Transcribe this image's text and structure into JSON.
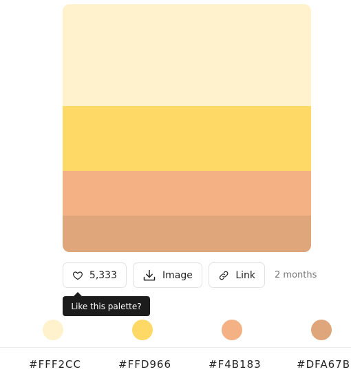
{
  "palette": {
    "colors": [
      "#FFF2CC",
      "#FFD966",
      "#F4B183",
      "#DFA67B"
    ]
  },
  "actions": {
    "like_count": "5,333",
    "image_label": "Image",
    "link_label": "Link",
    "age": "2 months"
  },
  "tooltip": {
    "text": "Like this palette?"
  },
  "codes": [
    "#FFF2CC",
    "#FFD966",
    "#F4B183",
    "#DFA67B"
  ],
  "icons": {
    "like": "heart-icon",
    "image": "download-icon",
    "link": "link-icon"
  }
}
